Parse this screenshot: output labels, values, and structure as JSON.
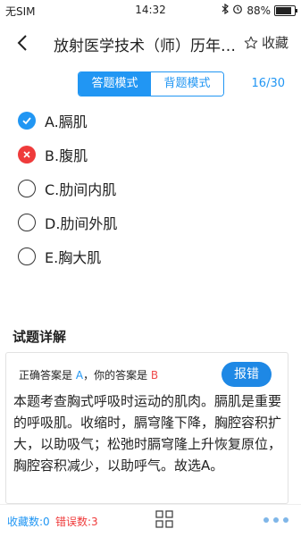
{
  "status_bar": {
    "carrier": "无SIM",
    "time": "14:32",
    "battery": "88%"
  },
  "header": {
    "title": "放射医学技术（师）历年…",
    "favorite_label": "收藏"
  },
  "mode": {
    "answer_mode": "答题模式",
    "recite_mode": "背题模式",
    "progress": "16/30"
  },
  "options": [
    {
      "label": "A.膈肌",
      "state": "correct"
    },
    {
      "label": "B.腹肌",
      "state": "wrong"
    },
    {
      "label": "C.肋间内肌",
      "state": "none"
    },
    {
      "label": "D.肋间外肌",
      "state": "none"
    },
    {
      "label": "E.胸大肌",
      "state": "none"
    }
  ],
  "detail": {
    "section_title": "试题详解",
    "correct_prefix": "正确答案是",
    "correct_answer": "A",
    "your_prefix": "，你的答案是",
    "your_answer": "B",
    "report_label": "报错",
    "explanation": "本题考查胸式呼吸时运动的肌肉。膈肌是重要的呼吸肌。收缩时，膈穹隆下降，胸腔容积扩大，以助吸气；松弛时膈穹隆上升恢复原位，胸腔容积减少，以助呼气。故选A。"
  },
  "bottom": {
    "favorites": "收藏数:0",
    "errors": "错误数:3"
  },
  "colors": {
    "accent": "#2196f3",
    "error": "#ef3b3b"
  }
}
